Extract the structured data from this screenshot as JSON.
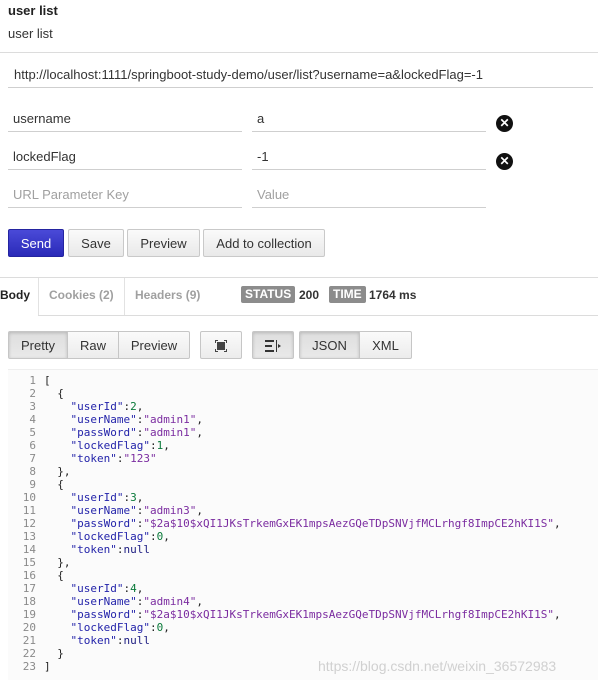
{
  "header": {
    "title": "user list",
    "subtitle": "user list"
  },
  "request": {
    "url": "http://localhost:1111/springboot-study-demo/user/list?username=a&lockedFlag=-1",
    "params": [
      {
        "key": "username",
        "value": "a"
      },
      {
        "key": "lockedFlag",
        "value": "-1"
      }
    ],
    "new_param": {
      "key_placeholder": "URL Parameter Key",
      "value_placeholder": "Value"
    },
    "buttons": {
      "send": "Send",
      "save": "Save",
      "preview": "Preview",
      "add_to_collection": "Add to collection"
    }
  },
  "response": {
    "tabs": {
      "body": "Body",
      "cookies": "Cookies (2)",
      "headers": "Headers (9)"
    },
    "status_label": "STATUS",
    "status_value": "200",
    "time_label": "TIME",
    "time_value": "1764 ms",
    "view_buttons": {
      "pretty": "Pretty",
      "raw": "Raw",
      "preview": "Preview",
      "json": "JSON",
      "xml": "XML"
    },
    "icons": {
      "fullscreen": "fullscreen-icon",
      "wrap": "wrap-lines-icon"
    },
    "line_numbers": [
      "1",
      "2",
      "3",
      "4",
      "5",
      "6",
      "7",
      "8",
      "9",
      "10",
      "11",
      "12",
      "13",
      "14",
      "15",
      "16",
      "17",
      "18",
      "19",
      "20",
      "21",
      "22",
      "23"
    ],
    "code_lines": [
      [
        {
          "t": "["
        }
      ],
      [
        {
          "t": "  {"
        }
      ],
      [
        {
          "t": "    "
        },
        {
          "c": "k",
          "t": "\"userId\""
        },
        {
          "t": ":"
        },
        {
          "c": "n",
          "t": "2"
        },
        {
          "t": ","
        }
      ],
      [
        {
          "t": "    "
        },
        {
          "c": "k",
          "t": "\"userName\""
        },
        {
          "t": ":"
        },
        {
          "c": "s",
          "t": "\"admin1\""
        },
        {
          "t": ","
        }
      ],
      [
        {
          "t": "    "
        },
        {
          "c": "k",
          "t": "\"passWord\""
        },
        {
          "t": ":"
        },
        {
          "c": "s",
          "t": "\"admin1\""
        },
        {
          "t": ","
        }
      ],
      [
        {
          "t": "    "
        },
        {
          "c": "k",
          "t": "\"lockedFlag\""
        },
        {
          "t": ":"
        },
        {
          "c": "n",
          "t": "1"
        },
        {
          "t": ","
        }
      ],
      [
        {
          "t": "    "
        },
        {
          "c": "k",
          "t": "\"token\""
        },
        {
          "t": ":"
        },
        {
          "c": "s",
          "t": "\"123\""
        }
      ],
      [
        {
          "t": "  },"
        }
      ],
      [
        {
          "t": "  {"
        }
      ],
      [
        {
          "t": "    "
        },
        {
          "c": "k",
          "t": "\"userId\""
        },
        {
          "t": ":"
        },
        {
          "c": "n",
          "t": "3"
        },
        {
          "t": ","
        }
      ],
      [
        {
          "t": "    "
        },
        {
          "c": "k",
          "t": "\"userName\""
        },
        {
          "t": ":"
        },
        {
          "c": "s",
          "t": "\"admin3\""
        },
        {
          "t": ","
        }
      ],
      [
        {
          "t": "    "
        },
        {
          "c": "k",
          "t": "\"passWord\""
        },
        {
          "t": ":"
        },
        {
          "c": "s",
          "t": "\"$2a$10$xQI1JKsTrkemGxEK1mpsAezGQeTDpSNVjfMCLrhgf8ImpCE2hKI1S\""
        },
        {
          "t": ","
        }
      ],
      [
        {
          "t": "    "
        },
        {
          "c": "k",
          "t": "\"lockedFlag\""
        },
        {
          "t": ":"
        },
        {
          "c": "n",
          "t": "0"
        },
        {
          "t": ","
        }
      ],
      [
        {
          "t": "    "
        },
        {
          "c": "k",
          "t": "\"token\""
        },
        {
          "t": ":"
        },
        {
          "c": "l",
          "t": "null"
        }
      ],
      [
        {
          "t": "  },"
        }
      ],
      [
        {
          "t": "  {"
        }
      ],
      [
        {
          "t": "    "
        },
        {
          "c": "k",
          "t": "\"userId\""
        },
        {
          "t": ":"
        },
        {
          "c": "n",
          "t": "4"
        },
        {
          "t": ","
        }
      ],
      [
        {
          "t": "    "
        },
        {
          "c": "k",
          "t": "\"userName\""
        },
        {
          "t": ":"
        },
        {
          "c": "s",
          "t": "\"admin4\""
        },
        {
          "t": ","
        }
      ],
      [
        {
          "t": "    "
        },
        {
          "c": "k",
          "t": "\"passWord\""
        },
        {
          "t": ":"
        },
        {
          "c": "s",
          "t": "\"$2a$10$xQI1JKsTrkemGxEK1mpsAezGQeTDpSNVjfMCLrhgf8ImpCE2hKI1S\""
        },
        {
          "t": ","
        }
      ],
      [
        {
          "t": "    "
        },
        {
          "c": "k",
          "t": "\"lockedFlag\""
        },
        {
          "t": ":"
        },
        {
          "c": "n",
          "t": "0"
        },
        {
          "t": ","
        }
      ],
      [
        {
          "t": "    "
        },
        {
          "c": "k",
          "t": "\"token\""
        },
        {
          "t": ":"
        },
        {
          "c": "l",
          "t": "null"
        }
      ],
      [
        {
          "t": "  }"
        }
      ],
      [
        {
          "t": "]"
        }
      ]
    ]
  },
  "watermark": "https://blog.csdn.net/weixin_36572983",
  "colors": {
    "send": "#2a2ab8",
    "badge": "#8c8c8c",
    "json_key": "#2424aa",
    "json_string": "#7b2ca0",
    "json_number": "#0a7a3a"
  }
}
